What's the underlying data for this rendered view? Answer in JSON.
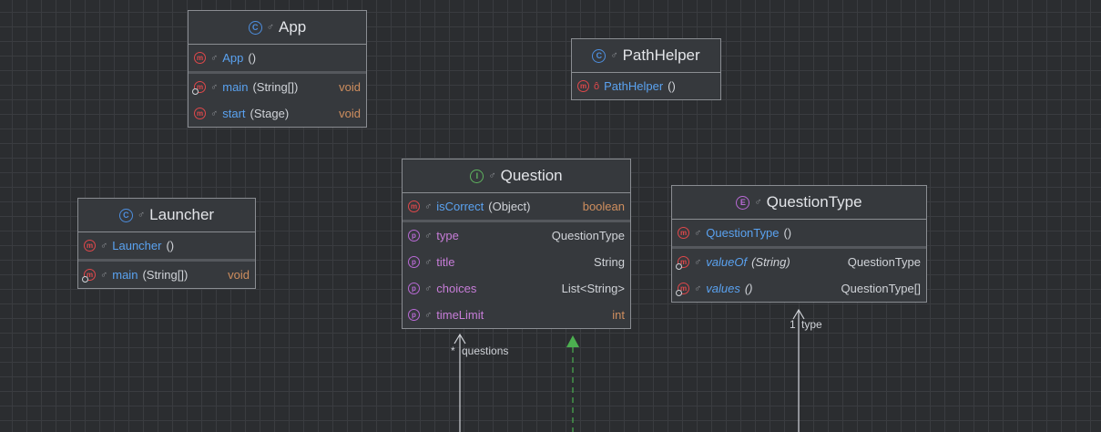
{
  "classes": {
    "app": {
      "name": "App",
      "constructor": {
        "name": "App",
        "params": "()"
      },
      "methods": [
        {
          "name": "main",
          "params": "(String[])",
          "type": "void"
        },
        {
          "name": "start",
          "params": "(Stage)",
          "type": "void"
        }
      ]
    },
    "path_helper": {
      "name": "PathHelper",
      "constructor": {
        "name": "PathHelper",
        "params": "()"
      }
    },
    "question": {
      "name": "Question",
      "method": {
        "name": "isCorrect",
        "params": "(Object)",
        "type": "boolean"
      },
      "fields": [
        {
          "name": "type",
          "type": "QuestionType"
        },
        {
          "name": "title",
          "type": "String"
        },
        {
          "name": "choices",
          "type": "List<String>"
        },
        {
          "name": "timeLimit",
          "type": "int"
        }
      ]
    },
    "launcher": {
      "name": "Launcher",
      "constructor": {
        "name": "Launcher",
        "params": "()"
      },
      "methods": [
        {
          "name": "main",
          "params": "(String[])",
          "type": "void"
        }
      ]
    },
    "question_type": {
      "name": "QuestionType",
      "constructor": {
        "name": "QuestionType",
        "params": "()"
      },
      "methods": [
        {
          "name": "valueOf",
          "params": "(String)",
          "type": "QuestionType"
        },
        {
          "name": "values",
          "params": "()",
          "type": "QuestionType[]"
        }
      ]
    }
  },
  "associations": {
    "questions": {
      "multiplicity": "*",
      "label": "questions"
    },
    "type": {
      "multiplicity": "1",
      "label": "type"
    }
  },
  "icons": {
    "class": "class-icon",
    "interface": "interface-icon",
    "enum": "enum-icon",
    "method": "method-icon",
    "field": "field-icon",
    "public": "public-visibility-icon",
    "private": "private-visibility-icon"
  },
  "colors": {
    "background": "#2b2d30",
    "method_name": "#5aa2f0",
    "field_name": "#c77dd8",
    "keyword_type": "#cf8e5e",
    "method_icon": "#e0484b",
    "inheritance_arrow": "#4caf50"
  }
}
